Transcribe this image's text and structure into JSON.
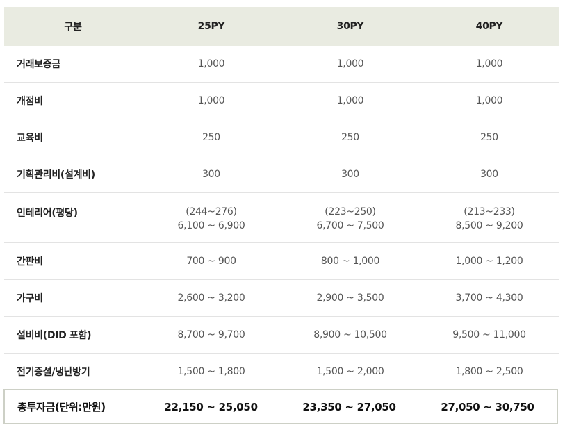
{
  "header": [
    "구분",
    "25PY",
    "30PY",
    "40PY"
  ],
  "rows": [
    {
      "label": "거래보증금",
      "v25": [
        "1,000"
      ],
      "v30": [
        "1,000"
      ],
      "v40": [
        "1,000"
      ]
    },
    {
      "label": "개점비",
      "v25": [
        "1,000"
      ],
      "v30": [
        "1,000"
      ],
      "v40": [
        "1,000"
      ]
    },
    {
      "label": "교육비",
      "v25": [
        "250"
      ],
      "v30": [
        "250"
      ],
      "v40": [
        "250"
      ]
    },
    {
      "label": "기획관리비(설계비)",
      "v25": [
        "300"
      ],
      "v30": [
        "300"
      ],
      "v40": [
        "300"
      ]
    },
    {
      "label": "인테리어(평당)",
      "v25": [
        "(244~276)",
        "6,100 ~ 6,900"
      ],
      "v30": [
        "(223~250)",
        "6,700 ~ 7,500"
      ],
      "v40": [
        "(213~233)",
        "8,500 ~ 9,200"
      ]
    },
    {
      "label": "간판비",
      "v25": [
        "700 ~ 900"
      ],
      "v30": [
        "800 ~ 1,000"
      ],
      "v40": [
        "1,000 ~ 1,200"
      ]
    },
    {
      "label": "가구비",
      "v25": [
        "2,600 ~ 3,200"
      ],
      "v30": [
        "2,900 ~ 3,500"
      ],
      "v40": [
        "3,700 ~ 4,300"
      ]
    },
    {
      "label": "설비비(DID 포함)",
      "v25": [
        "8,700 ~ 9,700"
      ],
      "v30": [
        "8,900 ~ 10,500"
      ],
      "v40": [
        "9,500 ~ 11,000"
      ]
    },
    {
      "label": "전기증설/냉난방기",
      "v25": [
        "1,500 ~ 1,800"
      ],
      "v30": [
        "1,500 ~ 2,000"
      ],
      "v40": [
        "1,800 ~ 2,500"
      ]
    }
  ],
  "total": {
    "label": "총투자금(단위:만원)",
    "v25": "22,150 ~ 25,050",
    "v30": "23,350 ~ 27,050",
    "v40": "27,050 ~ 30,750"
  },
  "colors": {
    "header_bg": "#e9ebe1",
    "total_border": "#cdd0c6"
  }
}
